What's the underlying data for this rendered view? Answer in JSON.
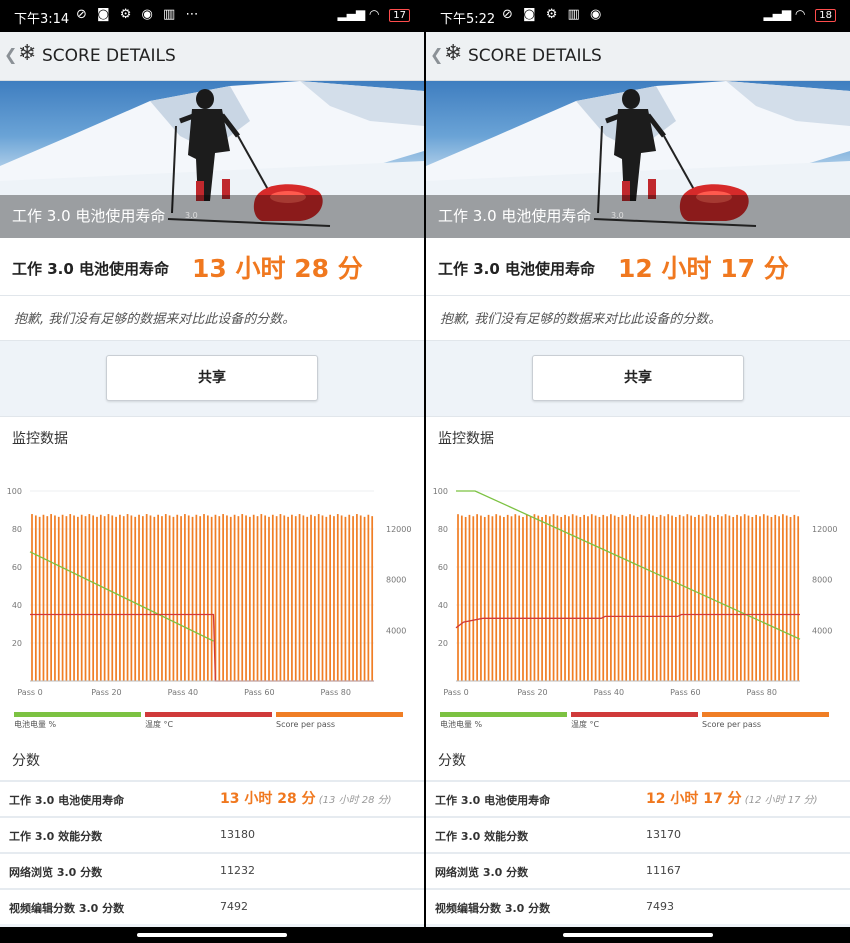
{
  "colors": {
    "accent": "#f0781f",
    "battery": "#7cc242",
    "temperature": "#d03a3a",
    "score": "#f07e25"
  },
  "screens": [
    {
      "status": {
        "time": "下午3:14",
        "icons": "⊘ ◙ ⚙ ◉ ▥ ⋯",
        "battery": "17",
        "signal": "▂▄▆ ◠"
      },
      "header": {
        "back": "❮",
        "snowflake": "❄",
        "title": "SCORE DETAILS"
      },
      "hero": {
        "overlay_title": "工作 3.0 电池使用寿命",
        "overlay_version": "3.0"
      },
      "score": {
        "label": "工作 3.0 电池使用寿命",
        "value": "13 小时 28 分"
      },
      "message": "抱歉, 我们没有足够的数据来对比此设备的分数。",
      "share_label": "共享",
      "monitor_title": "监控数据",
      "chart_data": {
        "type": "bar",
        "x": {
          "ticks": [
            "Pass 0",
            "Pass 20",
            "Pass 40",
            "Pass 60",
            "Pass 80"
          ],
          "range": [
            0,
            90
          ]
        },
        "y_left": {
          "ticks": [
            "100",
            "80",
            "60",
            "40",
            "20"
          ],
          "range": [
            0,
            100
          ]
        },
        "y_right": {
          "ticks": [
            "12000",
            "8000",
            "4000"
          ],
          "range": [
            0,
            15000
          ]
        },
        "series": [
          {
            "name": "Score per pass",
            "color": "#f07e25",
            "count": 90,
            "value": 13180
          },
          {
            "name": "电池电量 %",
            "color": "#7cc242",
            "points": [
              [
                0,
                68
              ],
              [
                48,
                21
              ]
            ]
          },
          {
            "name": "温度 °C",
            "color": "#d03a3a",
            "points": [
              [
                0,
                35
              ],
              [
                48,
                35
              ],
              [
                48.5,
                0
              ],
              [
                90,
                0
              ]
            ]
          }
        ],
        "legend_position": "bottom"
      },
      "fen_title": "分数",
      "rows": [
        {
          "label": "工作 3.0 电池使用寿命",
          "value": "13 小时 28 分",
          "sub": "(13 小时 28 分)"
        },
        {
          "label": "工作 3.0 效能分数",
          "value": "13180"
        },
        {
          "label": "网络浏览 3.0 分数",
          "value": "11232"
        },
        {
          "label": "视频编辑分数 3.0 分数",
          "value": "7492"
        }
      ]
    },
    {
      "status": {
        "time": "下午5:22",
        "icons": "⊘ ◙ ⚙ ▥ ◉",
        "battery": "18",
        "signal": "▂▄▆ ◠"
      },
      "header": {
        "back": "❮",
        "snowflake": "❄",
        "title": "SCORE DETAILS"
      },
      "hero": {
        "overlay_title": "工作 3.0 电池使用寿命",
        "overlay_version": "3.0"
      },
      "score": {
        "label": "工作 3.0 电池使用寿命",
        "value": "12 小时 17 分"
      },
      "message": "抱歉, 我们没有足够的数据来对比此设备的分数。",
      "share_label": "共享",
      "monitor_title": "监控数据",
      "chart_data": {
        "type": "bar",
        "x": {
          "ticks": [
            "Pass 0",
            "Pass 20",
            "Pass 40",
            "Pass 60",
            "Pass 80"
          ],
          "range": [
            0,
            90
          ]
        },
        "y_left": {
          "ticks": [
            "100",
            "80",
            "60",
            "40",
            "20"
          ],
          "range": [
            0,
            100
          ]
        },
        "y_right": {
          "ticks": [
            "12000",
            "8000",
            "4000"
          ],
          "range": [
            0,
            15000
          ]
        },
        "series": [
          {
            "name": "Score per pass",
            "color": "#f07e25",
            "count": 90,
            "value": 13170
          },
          {
            "name": "电池电量 %",
            "color": "#7cc242",
            "points": [
              [
                0,
                100
              ],
              [
                5,
                100
              ],
              [
                90,
                22
              ]
            ]
          },
          {
            "name": "温度 °C",
            "color": "#d03a3a",
            "points": [
              [
                0,
                28
              ],
              [
                2,
                31
              ],
              [
                7,
                33
              ],
              [
                38,
                33
              ],
              [
                39,
                34
              ],
              [
                58,
                34
              ],
              [
                59,
                35
              ],
              [
                90,
                35
              ]
            ]
          }
        ],
        "legend_position": "bottom"
      },
      "fen_title": "分数",
      "rows": [
        {
          "label": "工作 3.0 电池使用寿命",
          "value": "12 小时 17 分",
          "sub": "(12 小时 17 分)"
        },
        {
          "label": "工作 3.0 效能分数",
          "value": "13170"
        },
        {
          "label": "网络浏览 3.0 分数",
          "value": "11167"
        },
        {
          "label": "视频编辑分数 3.0 分数",
          "value": "7493"
        }
      ]
    }
  ]
}
